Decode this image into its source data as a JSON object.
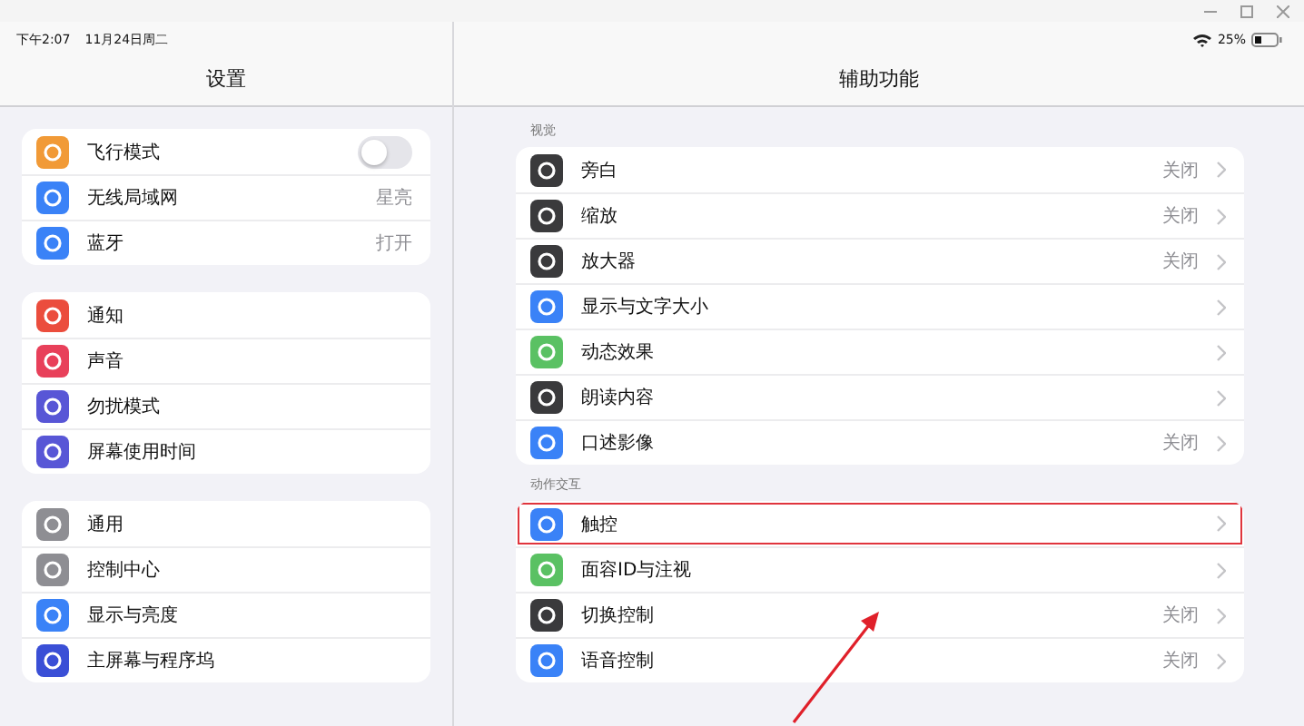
{
  "status_bar": {
    "time": "下午2:07",
    "date": "11月24日周二",
    "battery": "25%"
  },
  "sidebar": {
    "title": "设置",
    "groups": [
      {
        "items": [
          {
            "label": "飞行模式",
            "color": "#f19a37",
            "kind": "toggle",
            "on": false
          },
          {
            "label": "无线局域网",
            "color": "#3a82f7",
            "kind": "value",
            "value": "星亮"
          },
          {
            "label": "蓝牙",
            "color": "#3a82f7",
            "kind": "value",
            "value": "打开"
          }
        ]
      },
      {
        "items": [
          {
            "label": "通知",
            "color": "#eb4d3d",
            "kind": "plain"
          },
          {
            "label": "声音",
            "color": "#e8405a",
            "kind": "plain"
          },
          {
            "label": "勿扰模式",
            "color": "#5856d6",
            "kind": "plain"
          },
          {
            "label": "屏幕使用时间",
            "color": "#5856d6",
            "kind": "plain"
          }
        ]
      },
      {
        "items": [
          {
            "label": "通用",
            "color": "#8e8e93",
            "kind": "plain"
          },
          {
            "label": "控制中心",
            "color": "#8e8e93",
            "kind": "plain"
          },
          {
            "label": "显示与亮度",
            "color": "#3a82f7",
            "kind": "plain"
          },
          {
            "label": "主屏幕与程序坞",
            "color": "#3a4fd6",
            "kind": "plain"
          }
        ]
      }
    ]
  },
  "detail": {
    "title": "辅助功能",
    "sections": [
      {
        "header": "视觉",
        "items": [
          {
            "label": "旁白",
            "color": "#3a3a3c",
            "value": "关闭",
            "highlighted": false
          },
          {
            "label": "缩放",
            "color": "#3a3a3c",
            "value": "关闭",
            "highlighted": false
          },
          {
            "label": "放大器",
            "color": "#3a3a3c",
            "value": "关闭",
            "highlighted": false
          },
          {
            "label": "显示与文字大小",
            "color": "#3a82f7",
            "highlighted": false
          },
          {
            "label": "动态效果",
            "color": "#5ac163",
            "highlighted": false
          },
          {
            "label": "朗读内容",
            "color": "#3a3a3c",
            "highlighted": false
          },
          {
            "label": "口述影像",
            "color": "#3a82f7",
            "value": "关闭",
            "highlighted": false
          }
        ]
      },
      {
        "header": "动作交互",
        "items": [
          {
            "label": "触控",
            "color": "#3a82f7",
            "highlighted": true
          },
          {
            "label": "面容ID与注视",
            "color": "#5ac163",
            "highlighted": false
          },
          {
            "label": "切换控制",
            "color": "#3a3a3c",
            "value": "关闭",
            "highlighted": false
          },
          {
            "label": "语音控制",
            "color": "#3a82f7",
            "value": "关闭",
            "highlighted": false
          }
        ]
      }
    ]
  }
}
